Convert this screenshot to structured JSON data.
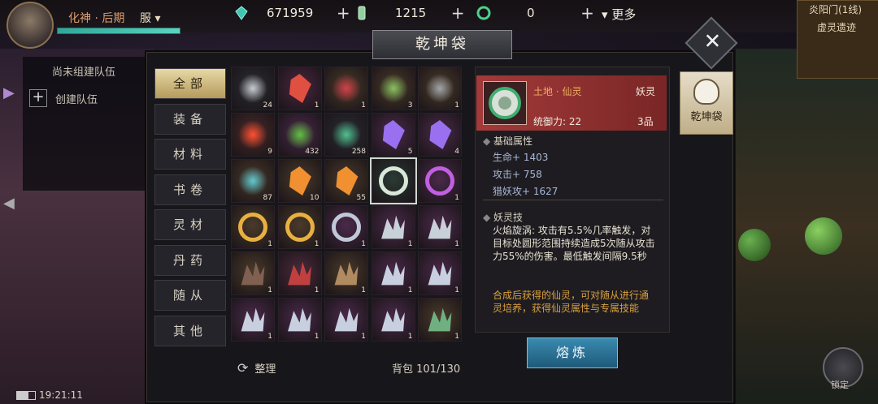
{
  "player": {
    "name": "化神 · 后期",
    "server_label": "服"
  },
  "resources": [
    {
      "icon": "jade-crystal-icon",
      "value": "671959"
    },
    {
      "icon": "scroll-token-icon",
      "value": "1215"
    },
    {
      "icon": "coin-ring-icon",
      "value": "0"
    }
  ],
  "more_label": "更多",
  "minimap": {
    "location": "炎阳门(1线)",
    "area": "虚灵遗迹"
  },
  "team": {
    "status": "尚未组建队伍",
    "create_label": "创建队伍"
  },
  "window_title": "乾坤袋",
  "tabs": [
    "全部",
    "装备",
    "材料",
    "书卷",
    "灵材",
    "丹药",
    "随从",
    "其他"
  ],
  "active_tab": "全部",
  "inventory": [
    {
      "icon": "silver-vase-icon",
      "qty": "24",
      "bg": "#2b2d33"
    },
    {
      "icon": "red-crystal-icon",
      "qty": "1",
      "bg": "#4a2640"
    },
    {
      "icon": "red-bonsai-icon",
      "qty": "1",
      "bg": "#4a3a2a"
    },
    {
      "icon": "bamboo-sprig-icon",
      "qty": "3",
      "bg": "#4a3a2a"
    },
    {
      "icon": "ore-rock-icon",
      "qty": "1",
      "bg": "#4a3a2a"
    },
    {
      "icon": "fire-flower-icon",
      "qty": "9",
      "bg": "#4a2a2a"
    },
    {
      "icon": "green-herb-icon",
      "qty": "432",
      "bg": "#4a2a4a"
    },
    {
      "icon": "jade-dagger-icon",
      "qty": "258",
      "bg": "#2b2d33"
    },
    {
      "icon": "purple-crystal-icon",
      "qty": "5",
      "bg": "#4a2a4a"
    },
    {
      "icon": "purple-crystal-icon",
      "qty": "4",
      "bg": "#4a2a4a"
    },
    {
      "icon": "teal-sand-icon",
      "qty": "87",
      "bg": "#4a3a2a"
    },
    {
      "icon": "amber-crystal-icon",
      "qty": "10",
      "bg": "#4a3a2a"
    },
    {
      "icon": "amber-crystal-icon",
      "qty": "55",
      "bg": "#4a3a2a"
    },
    {
      "icon": "jade-orb-icon",
      "qty": "",
      "bg": "#2b3a34",
      "selected": true
    },
    {
      "icon": "violet-ring-icon",
      "qty": "1",
      "bg": "#4a2a4a"
    },
    {
      "icon": "gold-ring-icon",
      "qty": "1",
      "bg": "#4a3a2a"
    },
    {
      "icon": "gold-ring-icon",
      "qty": "1",
      "bg": "#4a3a2a"
    },
    {
      "icon": "silver-claw-ring-icon",
      "qty": "1",
      "bg": "#4a2a4a"
    },
    {
      "icon": "silver-crescent-icon",
      "qty": "1",
      "bg": "#4a2a4a"
    },
    {
      "icon": "silver-crescent-icon",
      "qty": "1",
      "bg": "#4a2a4a"
    },
    {
      "icon": "dark-gauntlet-icon",
      "qty": "1",
      "bg": "#4a3a2a"
    },
    {
      "icon": "red-gauntlet-icon",
      "qty": "1",
      "bg": "#4a2a3a"
    },
    {
      "icon": "bronze-claw-icon",
      "qty": "1",
      "bg": "#4a3a2a"
    },
    {
      "icon": "silver-claw-icon",
      "qty": "1",
      "bg": "#4a2a4a"
    },
    {
      "icon": "silver-claw-icon",
      "qty": "1",
      "bg": "#4a2a4a"
    },
    {
      "icon": "silver-claw-icon",
      "qty": "1",
      "bg": "#4a2a4a"
    },
    {
      "icon": "silver-claw-icon",
      "qty": "1",
      "bg": "#4a2a4a"
    },
    {
      "icon": "silver-claw-icon",
      "qty": "1",
      "bg": "#4a2a4a"
    },
    {
      "icon": "silver-claw-icon",
      "qty": "1",
      "bg": "#4a2a4a"
    },
    {
      "icon": "jade-wing-claw-icon",
      "qty": "1",
      "bg": "#4a3a2a"
    }
  ],
  "sort_label": "整理",
  "bag_capacity": "背包 101/130",
  "detail": {
    "name": "土地 · 仙灵",
    "type": "妖灵",
    "command": "统御力: 22",
    "grade": "3品",
    "base_attr_title": "基础属性",
    "stats": [
      "生命+ 1403",
      "攻击+ 758",
      "猎妖攻+ 1627"
    ],
    "skill_title": "妖灵技",
    "skill_text": "火焰旋涡: 攻击有5.5%几率触发，对目标处圆形范围持续造成5次随从攻击力55%的伤害。最低触发间隔9.5秒",
    "note": "合成后获得的仙灵，可对随从进行通灵培养，获得仙灵属性与专属技能"
  },
  "refine_label": "熔炼",
  "bag_tab_label": "乾坤袋",
  "clock": "19:21:11",
  "lock_label": "锁定",
  "colors": {
    "active_tab": "#d9c68a",
    "header_red": "#a33a3a",
    "refine_blue": "#2e7aa0"
  }
}
